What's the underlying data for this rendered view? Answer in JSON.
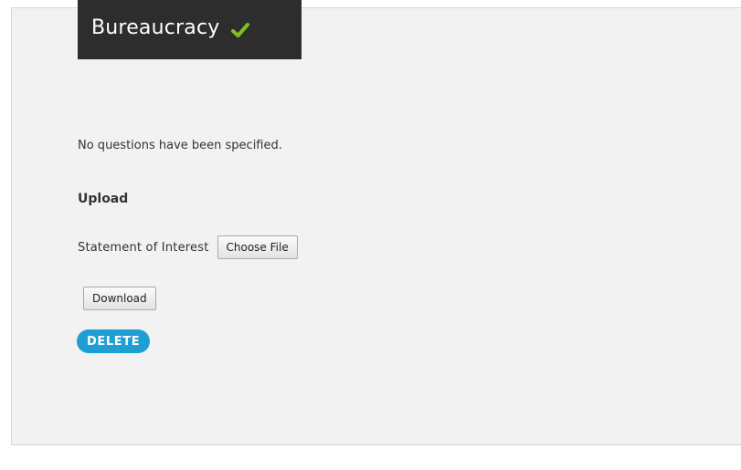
{
  "header": {
    "title": "Bureaucracy",
    "status_icon": "checkmark-icon",
    "status_color": "#7cc11f",
    "background_color": "#2d2d2d"
  },
  "content": {
    "message": "No questions have been specified.",
    "upload_section": {
      "heading": "Upload",
      "field_label": "Statement of Interest",
      "choose_file_label": "Choose File"
    },
    "download_label": "Download",
    "delete_label": "DELETE",
    "delete_color": "#1f9ed4"
  }
}
